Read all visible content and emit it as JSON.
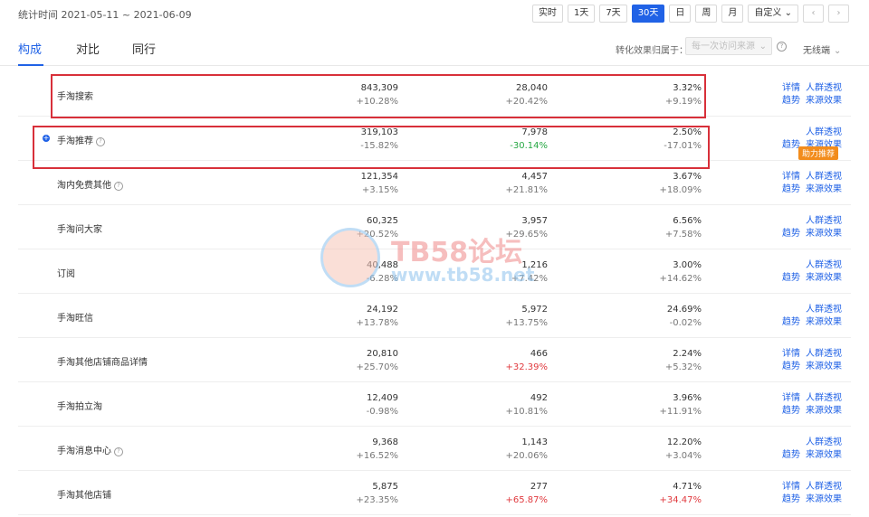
{
  "header": {
    "stat_time_label": "统计时间",
    "date_range": "2021-05-11 ~ 2021-06-09",
    "periods": [
      "实时",
      "1天",
      "7天",
      "30天",
      "日",
      "周",
      "月",
      "自定义"
    ],
    "active_period": "30天",
    "custom_caret": "⌄",
    "prev_icon": "chevron-left-icon",
    "next_icon": "chevron-right-icon"
  },
  "tabs": {
    "items": [
      "构成",
      "对比",
      "同行"
    ],
    "active": "构成"
  },
  "filters": {
    "attribution_label": "转化效果归属于：",
    "attribution_value": "每一次访问来源",
    "device_value": "无线端"
  },
  "rows": [
    {
      "name": "手淘搜索",
      "help": false,
      "expand": false,
      "v1": "843,309",
      "d1": "+10.28%",
      "d1t": "",
      "v2": "28,040",
      "d2": "+20.42%",
      "d2t": "",
      "v3": "3.32%",
      "d3": "+9.19%",
      "d3t": "",
      "links": {
        "detail": "详情",
        "crowd": "人群透视",
        "trend": "趋势",
        "source": "来源效果"
      },
      "badge": ""
    },
    {
      "name": "手淘推荐",
      "help": true,
      "expand": true,
      "v1": "319,103",
      "d1": "-15.82%",
      "d1t": "",
      "v2": "7,978",
      "d2": "-30.14%",
      "d2t": "down",
      "v3": "2.50%",
      "d3": "-17.01%",
      "d3t": "",
      "links": {
        "detail": "",
        "crowd": "人群透视",
        "trend": "趋势",
        "source": "来源效果"
      },
      "badge": "助力推荐"
    },
    {
      "name": "淘内免费其他",
      "help": true,
      "expand": false,
      "v1": "121,354",
      "d1": "+3.15%",
      "d1t": "",
      "v2": "4,457",
      "d2": "+21.81%",
      "d2t": "",
      "v3": "3.67%",
      "d3": "+18.09%",
      "d3t": "",
      "links": {
        "detail": "详情",
        "crowd": "人群透视",
        "trend": "趋势",
        "source": "来源效果"
      },
      "badge": ""
    },
    {
      "name": "手淘问大家",
      "help": false,
      "expand": false,
      "v1": "60,325",
      "d1": "+20.52%",
      "d1t": "",
      "v2": "3,957",
      "d2": "+29.65%",
      "d2t": "",
      "v3": "6.56%",
      "d3": "+7.58%",
      "d3t": "",
      "links": {
        "detail": "",
        "crowd": "人群透视",
        "trend": "趋势",
        "source": "来源效果"
      },
      "badge": ""
    },
    {
      "name": "订阅",
      "help": false,
      "expand": false,
      "v1": "40,488",
      "d1": "-6.28%",
      "d1t": "",
      "v2": "1,216",
      "d2": "+7.42%",
      "d2t": "",
      "v3": "3.00%",
      "d3": "+14.62%",
      "d3t": "",
      "links": {
        "detail": "",
        "crowd": "人群透视",
        "trend": "趋势",
        "source": "来源效果"
      },
      "badge": ""
    },
    {
      "name": "手淘旺信",
      "help": false,
      "expand": false,
      "v1": "24,192",
      "d1": "+13.78%",
      "d1t": "",
      "v2": "5,972",
      "d2": "+13.75%",
      "d2t": "",
      "v3": "24.69%",
      "d3": "-0.02%",
      "d3t": "",
      "links": {
        "detail": "",
        "crowd": "人群透视",
        "trend": "趋势",
        "source": "来源效果"
      },
      "badge": ""
    },
    {
      "name": "手淘其他店铺商品详情",
      "help": false,
      "expand": false,
      "v1": "20,810",
      "d1": "+25.70%",
      "d1t": "",
      "v2": "466",
      "d2": "+32.39%",
      "d2t": "up",
      "v3": "2.24%",
      "d3": "+5.32%",
      "d3t": "",
      "links": {
        "detail": "详情",
        "crowd": "人群透视",
        "trend": "趋势",
        "source": "来源效果"
      },
      "badge": ""
    },
    {
      "name": "手淘拍立淘",
      "help": false,
      "expand": false,
      "v1": "12,409",
      "d1": "-0.98%",
      "d1t": "",
      "v2": "492",
      "d2": "+10.81%",
      "d2t": "",
      "v3": "3.96%",
      "d3": "+11.91%",
      "d3t": "",
      "links": {
        "detail": "详情",
        "crowd": "人群透视",
        "trend": "趋势",
        "source": "来源效果"
      },
      "badge": ""
    },
    {
      "name": "手淘消息中心",
      "help": true,
      "expand": false,
      "v1": "9,368",
      "d1": "+16.52%",
      "d1t": "",
      "v2": "1,143",
      "d2": "+20.06%",
      "d2t": "",
      "v3": "12.20%",
      "d3": "+3.04%",
      "d3t": "",
      "links": {
        "detail": "",
        "crowd": "人群透视",
        "trend": "趋势",
        "source": "来源效果"
      },
      "badge": ""
    },
    {
      "name": "手淘其他店铺",
      "help": false,
      "expand": false,
      "v1": "5,875",
      "d1": "+23.35%",
      "d1t": "",
      "v2": "277",
      "d2": "+65.87%",
      "d2t": "up",
      "v3": "4.71%",
      "d3": "+34.47%",
      "d3t": "up",
      "links": {
        "detail": "详情",
        "crowd": "人群透视",
        "trend": "趋势",
        "source": "来源效果"
      },
      "badge": ""
    }
  ],
  "watermark": {
    "title": "TB58论坛",
    "url": "www.tb58.net"
  },
  "colors": {
    "accent": "#2062e6",
    "up": "#e0393e",
    "down": "#27a844",
    "badge": "#f28c1c",
    "highlight": "#d8303a"
  }
}
